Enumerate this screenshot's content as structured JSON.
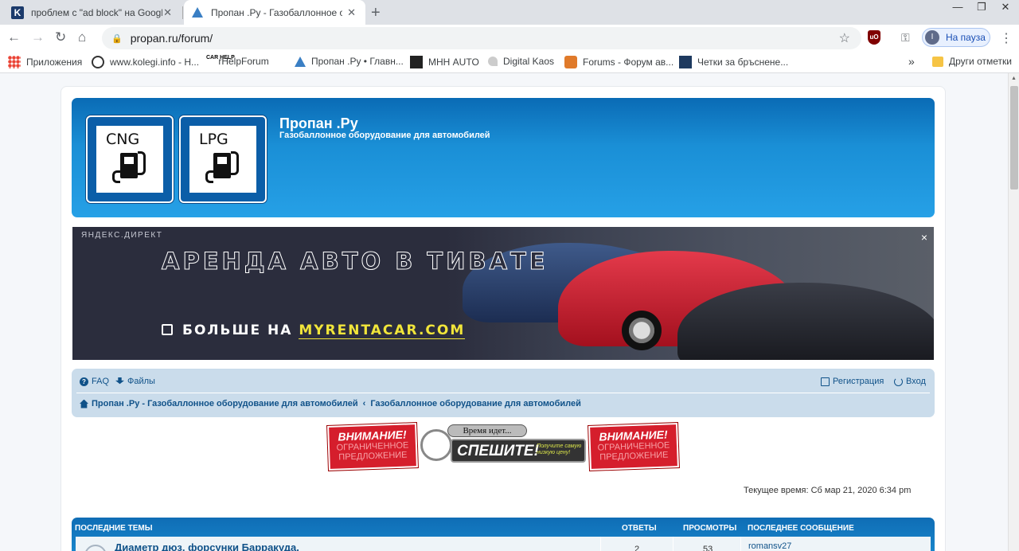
{
  "browser": {
    "tabs": [
      {
        "title": "проблем с \"ad block\" на Google",
        "icon": "kolegi-favicon"
      },
      {
        "title": "Пропан .Ру - Газобаллонное об",
        "icon": "propan-favicon"
      }
    ],
    "url": "propan.ru/forum/",
    "profile_label": "На пауза",
    "profile_initial": "I",
    "extension_label": "uO",
    "bookmarks": [
      {
        "label": "Приложения",
        "icon": "apps-grid-icon"
      },
      {
        "label": "www.kolegi.info - Н...",
        "icon": "circle-logo-icon"
      },
      {
        "label": "CarHelpForum",
        "icon": "carhelp-icon"
      },
      {
        "label": "Пропан .Ру • Главн...",
        "icon": "propan-triangle-icon"
      },
      {
        "label": "МНН AUTO",
        "icon": "dark-logo-icon"
      },
      {
        "label": "Digital Kaos",
        "icon": "pin-icon"
      },
      {
        "label": "Forums - Форум ав...",
        "icon": "orange-car-icon"
      },
      {
        "label": "Четки за бръснене...",
        "icon": "navy-logo-icon"
      }
    ],
    "other_bookmarks": "Други отметки"
  },
  "site": {
    "logo1": "CNG",
    "logo2": "LPG",
    "title": "Пропан .Ру",
    "description": "Газобаллонное оборудование для автомобилей"
  },
  "ad": {
    "tag": "ЯНДЕКС.ДИРЕКТ",
    "headline": "АРЕНДА АВТО В ТИВАТЕ",
    "more_prefix": "БОЛЬШЕ НА",
    "more_site": "MYRENTACAR.COM",
    "close": "×"
  },
  "navbar": {
    "faq": "FAQ",
    "files": "Файлы",
    "register": "Регистрация",
    "login": "Вход",
    "breadcrumb_home": "Пропан .Ру - Газобаллонное оборудование для автомобилей",
    "breadcrumb_sep": "‹",
    "breadcrumb_current": "Газобаллонное оборудование для автомобилей"
  },
  "promo": {
    "badge_title": "ВНИМАНИЕ!",
    "badge_sub": "ОГРАНИЧЕННОЕ ПРЕДЛОЖЕНИЕ",
    "time_label": "Время идет...",
    "hurry": "СПЕШИТЕ!",
    "hurry_sub": "Получите самую низкую цену!"
  },
  "current_time": "Текущее время: Сб мар 21, 2020 6:34 pm",
  "topics": {
    "headers": {
      "topics": "ПОСЛЕДНИЕ ТЕМЫ",
      "replies": "ОТВЕТЫ",
      "views": "ПРОСМОТРЫ",
      "last_post": "ПОСЛЕДНЕЕ СООБЩЕНИЕ"
    },
    "rows": [
      {
        "title": "Диаметр дюз, форсунки Барракуда.",
        "replies": "2",
        "views": "53",
        "author": "romansv27"
      }
    ]
  }
}
